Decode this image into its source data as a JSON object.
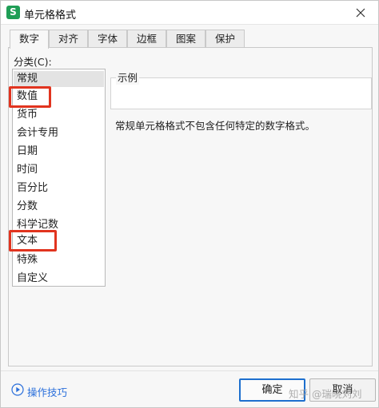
{
  "window": {
    "app_icon_letter": "S",
    "title": "单元格格式"
  },
  "tabs": [
    {
      "label": "数字",
      "active": true
    },
    {
      "label": "对齐",
      "active": false
    },
    {
      "label": "字体",
      "active": false
    },
    {
      "label": "边框",
      "active": false
    },
    {
      "label": "图案",
      "active": false
    },
    {
      "label": "保护",
      "active": false
    }
  ],
  "category": {
    "label": "分类(C):",
    "items": [
      "常规",
      "数值",
      "货币",
      "会计专用",
      "日期",
      "时间",
      "百分比",
      "分数",
      "科学记数",
      "文本",
      "特殊",
      "自定义"
    ],
    "selected": "常规",
    "highlighted": [
      "数值",
      "文本"
    ],
    "highlight_color": "#e1341f"
  },
  "sample": {
    "label": "示例",
    "value": ""
  },
  "description": "常规单元格格式不包含任何特定的数字格式。",
  "footer": {
    "help_link": "操作技巧",
    "ok_label": "确定",
    "cancel_label": "取消"
  },
  "watermark": "知乎 @瑞晓刘刘",
  "colors": {
    "accent": "#1d6fce",
    "link": "#2a6fdb",
    "app_icon": "#1f9e56"
  }
}
